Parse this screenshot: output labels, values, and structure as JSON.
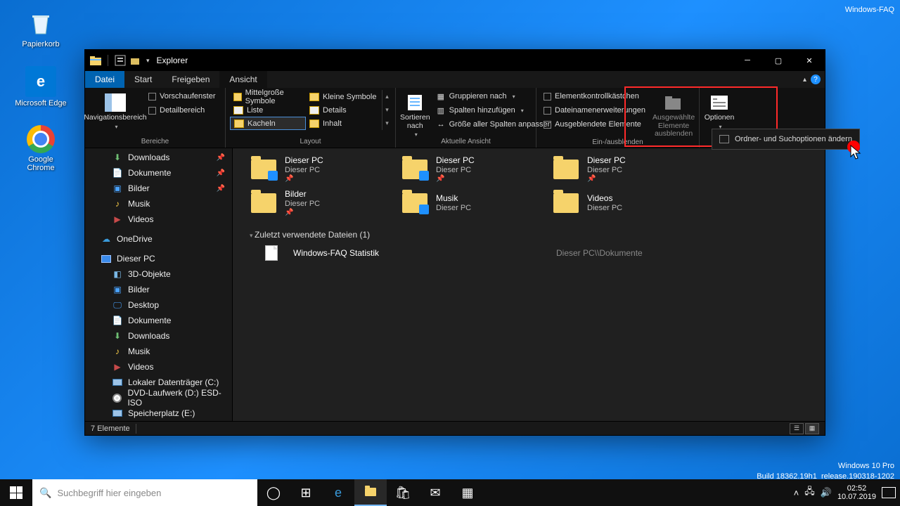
{
  "desktop": {
    "recycle": "Papierkorb",
    "edge": "Microsoft Edge",
    "chrome": "Google Chrome"
  },
  "watermark_top": "Windows-FAQ",
  "watermark_ver": "Windows 10 Pro",
  "watermark_build": "Build 18362.19h1_release.190318-1202",
  "window": {
    "title": "Explorer",
    "tabs": {
      "file": "Datei",
      "start": "Start",
      "share": "Freigeben",
      "view": "Ansicht"
    },
    "ribbon": {
      "panes": {
        "nav": "Navigationsbereich",
        "preview": "Vorschaufenster",
        "details": "Detailbereich",
        "group": "Bereiche"
      },
      "layout": {
        "medium": "Mittelgroße Symbole",
        "small": "Kleine Symbole",
        "list": "Liste",
        "details": "Details",
        "tiles": "Kacheln",
        "content": "Inhalt",
        "group": "Layout"
      },
      "currentview": {
        "sort": "Sortieren nach",
        "groupby": "Gruppieren nach",
        "addcol": "Spalten hinzufügen",
        "autosize": "Größe aller Spalten anpassen",
        "group": "Aktuelle Ansicht"
      },
      "showhide": {
        "itemcheck": "Elementkontrollkästchen",
        "ext": "Dateinamenerweiterungen",
        "hidden": "Ausgeblendete Elemente",
        "hidebtn_l1": "Ausgewählte",
        "hidebtn_l2": "Elemente ausblenden",
        "group": "Ein-/ausblenden"
      },
      "options": {
        "label": "Optionen",
        "menu_item": "Ordner- und Suchoptionen ändern"
      }
    },
    "nav": {
      "downloads": "Downloads",
      "documents": "Dokumente",
      "pictures": "Bilder",
      "music": "Musik",
      "videos": "Videos",
      "onedrive": "OneDrive",
      "thispc": "Dieser PC",
      "objects3d": "3D-Objekte",
      "pictures2": "Bilder",
      "desktop": "Desktop",
      "documents2": "Dokumente",
      "downloads2": "Downloads",
      "music2": "Musik",
      "videos2": "Videos",
      "localdisk": "Lokaler Datenträger (C:)",
      "dvd": "DVD-Laufwerk (D:) ESD-ISO",
      "storage": "Speicherplatz (E:)"
    },
    "content": {
      "thispc": "Dieser PC",
      "f_pictures": "Bilder",
      "f_music": "Musik",
      "f_videos": "Videos",
      "recent_header": "Zuletzt verwendete Dateien (1)",
      "recent_file": "Windows-FAQ Statistik",
      "recent_path": "Dieser PC\\\\Dokumente"
    },
    "status": "7 Elemente"
  },
  "taskbar": {
    "search_placeholder": "Suchbegriff hier eingeben",
    "time": "02:52",
    "date": "10.07.2019"
  }
}
